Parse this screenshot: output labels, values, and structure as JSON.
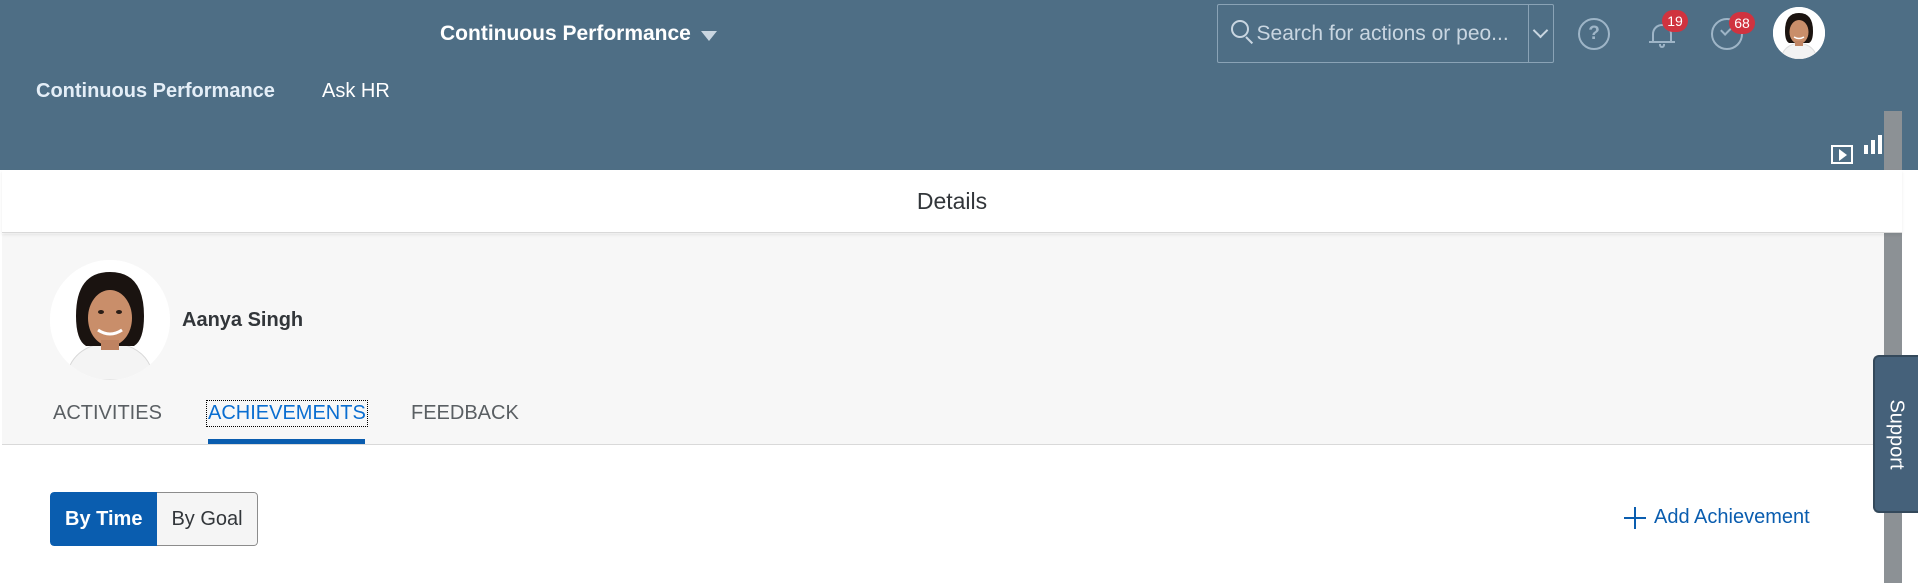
{
  "header": {
    "app_title": "Continuous Performance",
    "search": {
      "placeholder": "Search for actions or peo..."
    },
    "notifications_count": "19",
    "approvals_count": "68",
    "help_glyph": "?"
  },
  "nav": {
    "items": [
      {
        "label": "Continuous Performance"
      },
      {
        "label": "Ask HR"
      }
    ]
  },
  "dialog": {
    "title": "Details",
    "person_name": "Aanya Singh",
    "tabs": [
      {
        "label": "ACTIVITIES"
      },
      {
        "label": "ACHIEVEMENTS"
      },
      {
        "label": "FEEDBACK"
      }
    ],
    "active_tab": "ACHIEVEMENTS",
    "view_toggle": {
      "by_time": "By Time",
      "by_goal": "By Goal",
      "selected": "By Time"
    },
    "add_achievement": "Add Achievement"
  },
  "support": {
    "label": "Support"
  },
  "colors": {
    "shell": "#4e6e85",
    "accent": "#0a5daf",
    "badge": "#d0333f",
    "profile_bg": "#f7f7f7"
  },
  "icons": [
    "caret-down-icon",
    "search-icon",
    "chevron-down-icon",
    "help-icon",
    "bell-icon",
    "approval-icon",
    "play-icon",
    "bar-chart-icon",
    "plus-icon"
  ]
}
